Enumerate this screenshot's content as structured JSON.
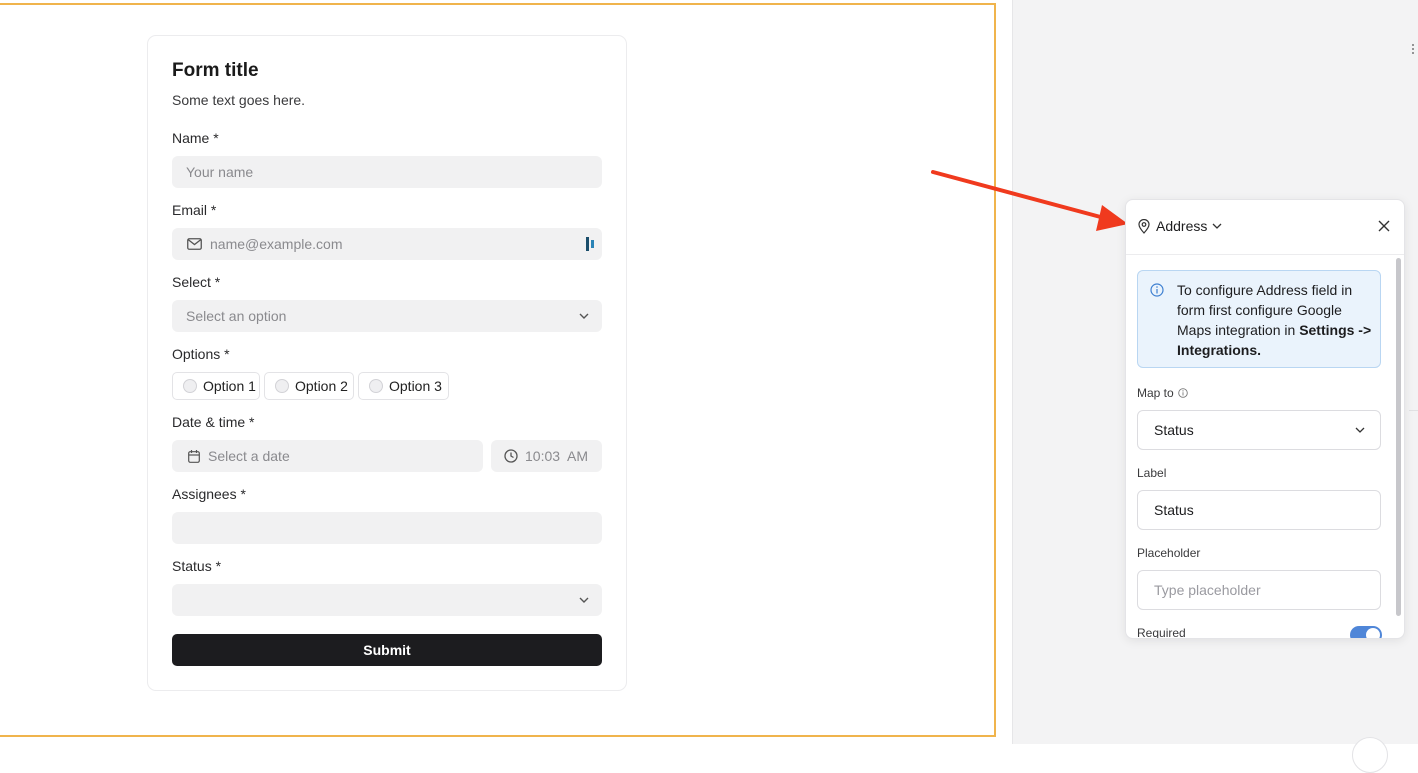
{
  "form": {
    "title": "Form title",
    "subtitle": "Some text goes here.",
    "name_label": "Name *",
    "name_placeholder": "Your name",
    "email_label": "Email *",
    "email_placeholder": "name@example.com",
    "select_label": "Select *",
    "select_placeholder": "Select an option",
    "options_label": "Options *",
    "options": [
      "Option 1",
      "Option 2",
      "Option 3"
    ],
    "datetime_label": "Date & time *",
    "date_placeholder": "Select a date",
    "time_value": "10:03  AM",
    "assignees_label": "Assignees *",
    "status_label": "Status *",
    "submit_label": "Submit"
  },
  "popover": {
    "field_type": "Address",
    "info_text_plain": "To configure Address field in form first configure Google Maps integration in ",
    "info_text_bold": "Settings -> Integrations.",
    "map_to_label": "Map to",
    "map_to_value": "Status",
    "label_label": "Label",
    "label_value": "Status",
    "placeholder_label": "Placeholder",
    "placeholder_placeholder": "Type placeholder",
    "required_label": "Required",
    "required_on": true
  },
  "colors": {
    "canvas_border": "#f0b44c",
    "arrow": "#f03a1e",
    "info_bg": "#eaf3fc",
    "toggle_on": "#4f86d8",
    "submit_bg": "#1c1c1f"
  }
}
